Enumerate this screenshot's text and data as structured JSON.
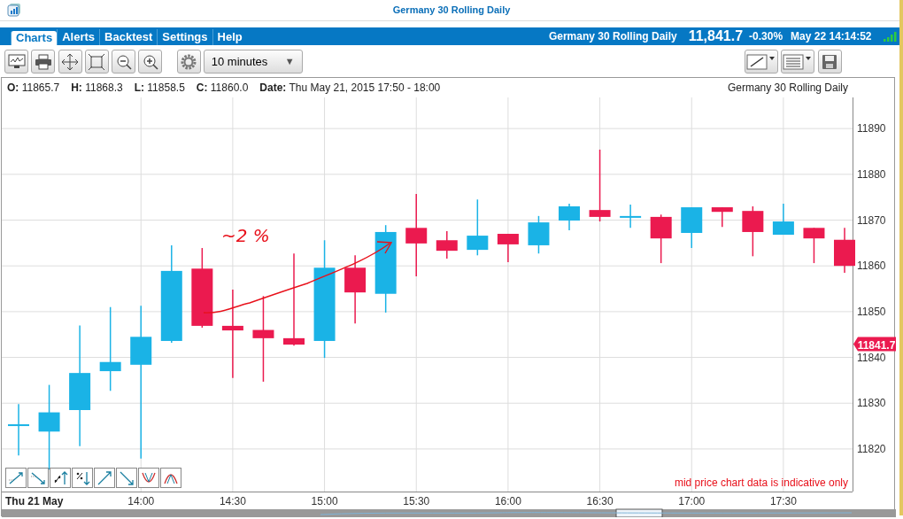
{
  "window": {
    "title": "Germany 30 Rolling Daily"
  },
  "nav": {
    "tabs": [
      {
        "label": "Charts",
        "selected": true
      },
      {
        "label": "Alerts",
        "selected": false
      },
      {
        "label": "Backtest",
        "selected": false
      },
      {
        "label": "Settings",
        "selected": false
      },
      {
        "label": "Help",
        "selected": false
      }
    ],
    "instrument": "Germany 30 Rolling Daily",
    "price": "11,841.7",
    "change": "-0.30%",
    "time": "May 22 14:14:52"
  },
  "toolbar": {
    "interval": "10 minutes",
    "interval_caret": "▼"
  },
  "info": {
    "fields": [
      {
        "label": "O:",
        "value": "11865.7"
      },
      {
        "label": "H:",
        "value": "11868.3"
      },
      {
        "label": "L:",
        "value": "11858.5"
      },
      {
        "label": "C:",
        "value": "11860.0"
      },
      {
        "label": "Date:",
        "value": "Thu May 21, 2015 17:50 - 18:00"
      }
    ],
    "instrument": "Germany 30 Rolling Daily"
  },
  "chart": {
    "last_price": "11841.7",
    "disclaimer": "mid price chart data is indicative only",
    "chart_data": {
      "type": "candlestick",
      "xlabel": "Thu 21 May",
      "grid": true,
      "x": [
        800,
        810,
        820,
        830,
        840,
        850,
        860,
        870,
        880,
        890,
        900,
        910,
        920,
        930,
        940,
        950,
        960,
        970,
        980,
        990,
        1000,
        1010,
        1020,
        1030,
        1040,
        1050,
        1060,
        1070
      ],
      "series": [
        {
          "color": "#1ab3e6",
          "ohlc": [
            [
              11825.2,
              11829.8,
              11818.6,
              11825.2
            ],
            [
              11823.8,
              11834.0,
              11815.5,
              11828.0
            ],
            [
              11828.5,
              11847.0,
              11820.6,
              11836.6
            ],
            [
              11837.0,
              11851.0,
              11832.7,
              11839.0
            ],
            [
              11838.4,
              11851.3,
              11817.9,
              11844.5
            ],
            [
              11843.6,
              11864.5,
              11843.2,
              11858.9
            ],
            null,
            null,
            null,
            null,
            [
              11843.6,
              11865.6,
              11839.9,
              11859.6
            ],
            null,
            [
              11853.9,
              11868.9,
              11849.8,
              11867.4
            ],
            null,
            null,
            [
              11863.5,
              11874.5,
              11862.3,
              11866.6
            ],
            null,
            [
              11864.5,
              11870.9,
              11862.7,
              11869.5
            ],
            [
              11869.9,
              11873.6,
              11867.8,
              11873.0
            ],
            null,
            [
              11870.7,
              11873.4,
              11868.3,
              11870.7
            ],
            null,
            [
              11867.2,
              11872.8,
              11863.9,
              11872.8
            ],
            null,
            null,
            [
              11866.8,
              11873.6,
              11866.8,
              11869.7
            ],
            null,
            null
          ]
        },
        {
          "color": "#eb1a4f",
          "ohlc": [
            null,
            null,
            null,
            null,
            null,
            null,
            [
              11859.4,
              11863.9,
              11846.5,
              11846.9
            ],
            [
              11846.9,
              11854.8,
              11835.5,
              11845.9
            ],
            [
              11846.0,
              11853.4,
              11834.7,
              11844.2
            ],
            [
              11844.2,
              11862.7,
              11842.6,
              11842.8
            ],
            null,
            [
              11859.6,
              11862.3,
              11847.4,
              11854.2
            ],
            null,
            [
              11868.3,
              11875.7,
              11857.7,
              11864.9
            ],
            [
              11865.6,
              11867.6,
              11861.6,
              11863.3
            ],
            null,
            [
              11867.0,
              11867.0,
              11860.8,
              11864.7
            ],
            null,
            null,
            [
              11872.2,
              11885.4,
              11869.7,
              11870.7
            ],
            null,
            [
              11870.7,
              11871.2,
              11860.6,
              11866.0
            ],
            null,
            [
              11872.8,
              11872.8,
              11868.5,
              11871.8
            ],
            [
              11872.0,
              11873.0,
              11862.1,
              11867.4
            ],
            null,
            [
              11868.3,
              11868.3,
              11860.6,
              11866.0
            ],
            [
              11865.7,
              11868.3,
              11858.5,
              11860.0
            ]
          ]
        }
      ],
      "xlim": [
        794.5,
        1072.6
      ],
      "ylim": [
        11810.7,
        11896.8
      ],
      "yticks": [
        11820,
        11830,
        11840,
        11850,
        11860,
        11870,
        11880,
        11890
      ],
      "xticks": [
        {
          "value": 840,
          "label": "14:00"
        },
        {
          "value": 870,
          "label": "14:30"
        },
        {
          "value": 900,
          "label": "15:00"
        },
        {
          "value": 930,
          "label": "15:30"
        },
        {
          "value": 960,
          "label": "16:00"
        },
        {
          "value": 990,
          "label": "16:30"
        },
        {
          "value": 1020,
          "label": "17:00"
        },
        {
          "value": 1050,
          "label": "17:30"
        }
      ],
      "annotations": [
        {
          "text": "~2 %"
        }
      ]
    }
  }
}
